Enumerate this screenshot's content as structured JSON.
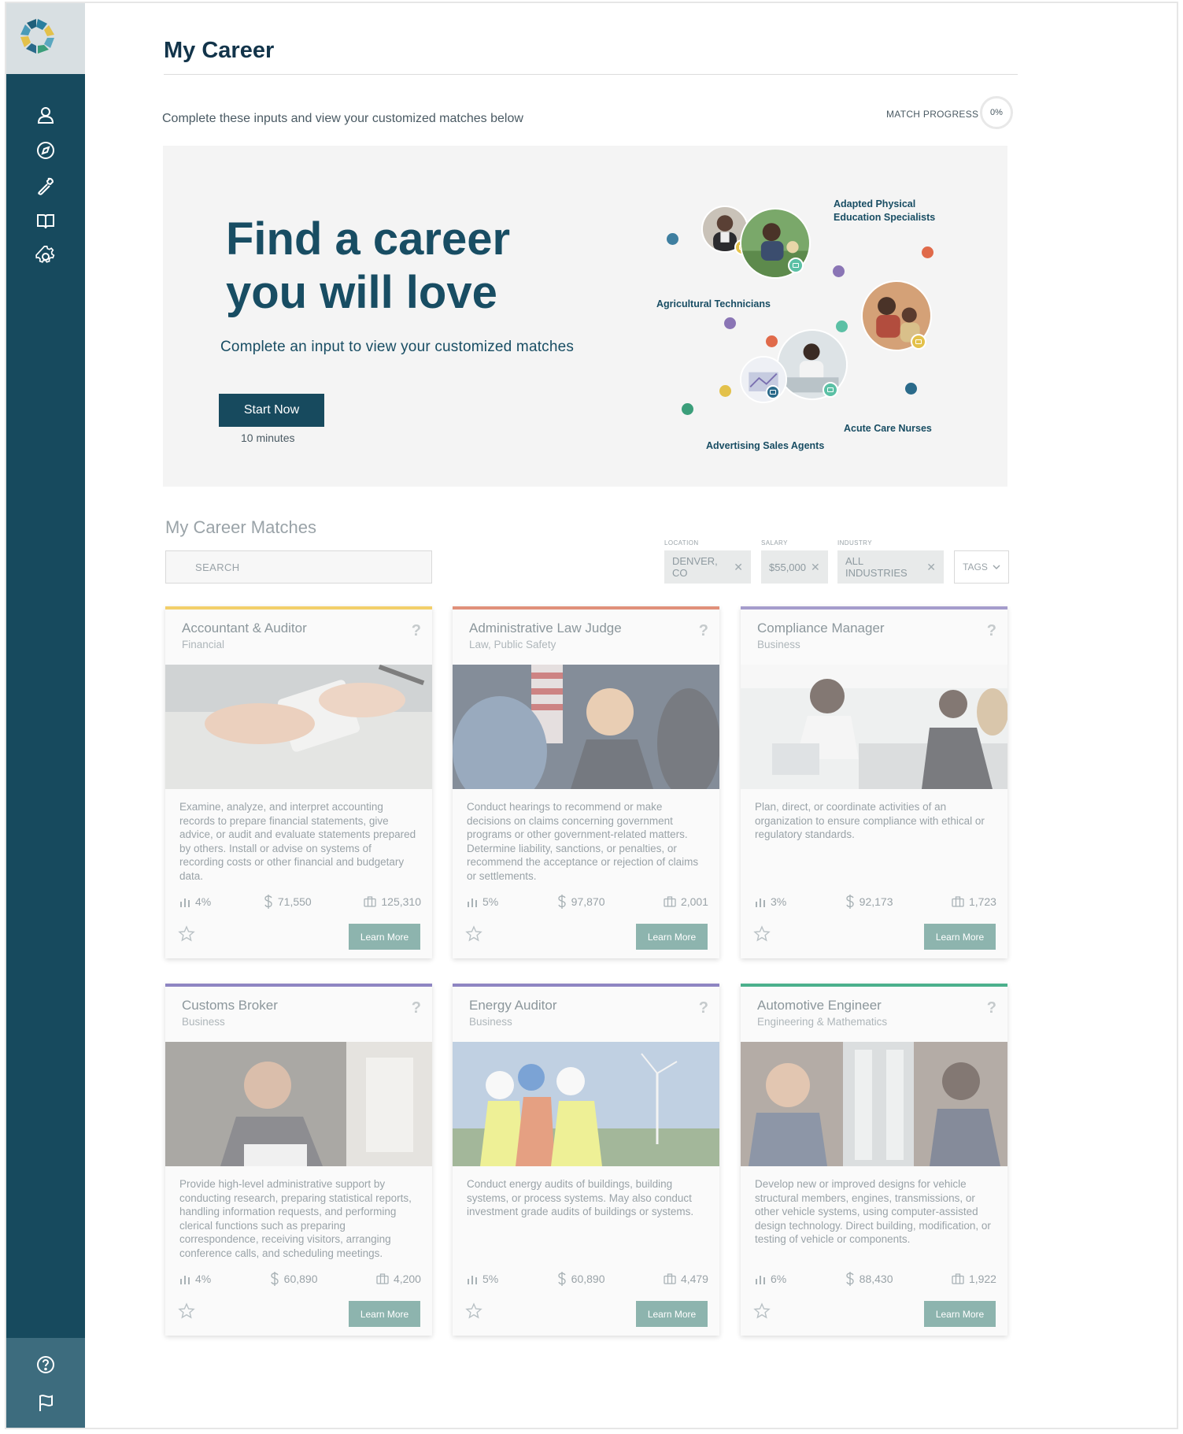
{
  "page": {
    "title": "My Career",
    "subtitle": "Complete these inputs and view your customized matches below",
    "progress_label": "MATCH PROGRESS",
    "progress_value": "0%"
  },
  "sidebar": {
    "items": [
      {
        "name": "profile",
        "icon": "user-icon"
      },
      {
        "name": "explore",
        "icon": "compass-icon"
      },
      {
        "name": "tools",
        "icon": "wrench-icon"
      },
      {
        "name": "learn",
        "icon": "book-icon"
      },
      {
        "name": "settings",
        "icon": "gear-icon"
      }
    ],
    "bottom": [
      {
        "name": "help",
        "icon": "help-icon"
      },
      {
        "name": "report",
        "icon": "flag-icon"
      }
    ]
  },
  "hero": {
    "heading": "Find a career you will love",
    "sub": "Complete an input to view your customized matches",
    "start_label": "Start Now",
    "time_label": "10 minutes",
    "jobs": [
      "Adapted Physical Education Specialists",
      "Agricultural Technicians",
      "Acute Care Nurses",
      "Advertising Sales Agents"
    ]
  },
  "matches": {
    "title": "My Career Matches",
    "search_placeholder": "SEARCH",
    "filters": {
      "location_caption": "LOCATION",
      "location_value": "DENVER, CO",
      "salary_caption": "SALARY",
      "salary_value": "$55,000",
      "industry_caption": "INDUSTRY",
      "industry_value": "ALL INDUSTRIES",
      "tags_label": "TAGS"
    },
    "learn_more_label": "Learn More",
    "cards": [
      {
        "title": "Accountant & Auditor",
        "category": "Financial",
        "accent": "#f2cf6a",
        "description": "Examine, analyze, and interpret accounting records to prepare financial statements, give advice, or audit and evaluate statements prepared by others. Install or advise on systems of recording costs or other financial and budgetary data.",
        "growth": "4%",
        "salary": "71,550",
        "jobs": "125,310"
      },
      {
        "title": "Administrative Law Judge",
        "category": "Law, Public Safety",
        "accent": "#e0907a",
        "description": "Conduct hearings to recommend or make decisions on claims concerning government programs or other government-related matters. Determine liability, sanctions, or penalties, or recommend the acceptance or rejection of claims or settlements.",
        "growth": "5%",
        "salary": "97,870",
        "jobs": "2,001"
      },
      {
        "title": "Compliance Manager",
        "category": "Business",
        "accent": "#a59ccc",
        "description": "Plan, direct, or coordinate activities of an organization to ensure compliance with ethical or regulatory standards.",
        "growth": "3%",
        "salary": "92,173",
        "jobs": "1,723"
      },
      {
        "title": "Customs Broker",
        "category": "Business",
        "accent": "#8e85c2",
        "description": "Provide high-level administrative support by conducting research, preparing statistical reports, handling information requests, and performing clerical functions such as preparing correspondence, receiving visitors, arranging conference calls, and scheduling meetings.",
        "growth": "4%",
        "salary": "60,890",
        "jobs": "4,200"
      },
      {
        "title": "Energy Auditor",
        "category": "Business",
        "accent": "#8e85c2",
        "description": "Conduct energy audits of buildings, building systems, or process systems. May also conduct investment grade audits of buildings or systems.",
        "growth": "5%",
        "salary": "60,890",
        "jobs": "4,479"
      },
      {
        "title": "Automotive Engineer",
        "category": "Engineering & Mathematics",
        "accent": "#4bb08c",
        "description": "Develop new or improved designs for vehicle structural members, engines, transmissions, or other vehicle systems, using computer-assisted design technology. Direct building, modification, or testing of vehicle or components.",
        "growth": "6%",
        "salary": "88,430",
        "jobs": "1,922"
      }
    ]
  },
  "colors": {
    "sidebar": "#174a5e",
    "primary": "#174a5e",
    "learn_button": "#8db4ae",
    "hero_bg": "#f4f4f4"
  }
}
